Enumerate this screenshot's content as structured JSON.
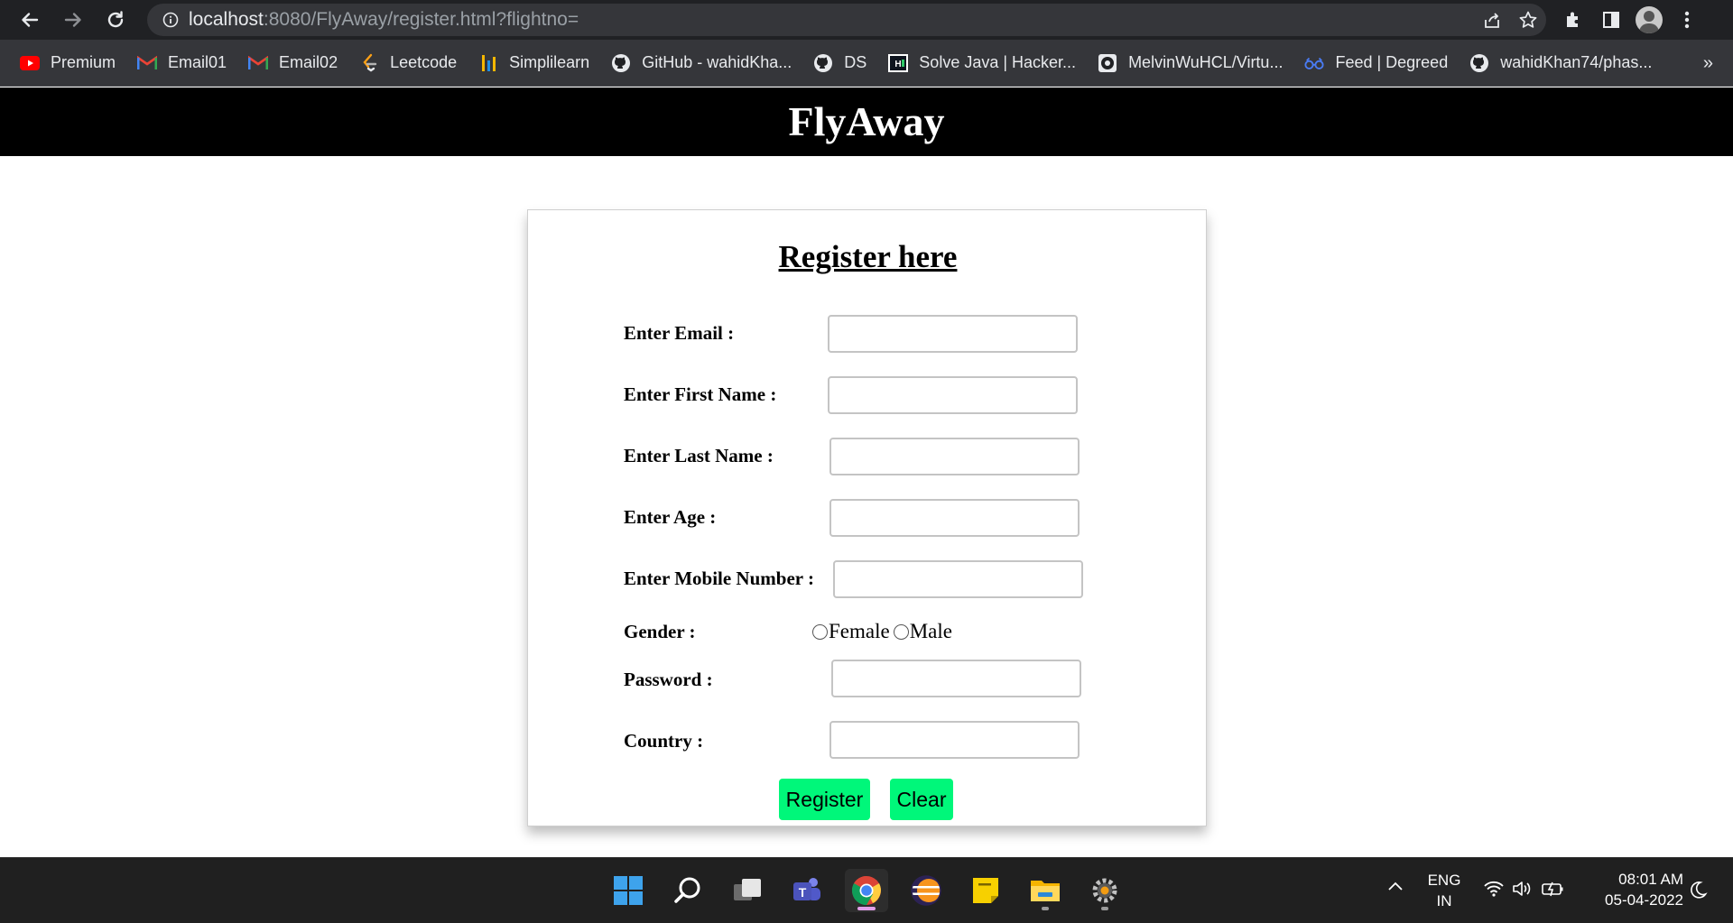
{
  "browser": {
    "url_host": "localhost",
    "url_rest": ":8080/FlyAway/register.html?flightno=",
    "bookmarks": [
      {
        "label": "Premium",
        "icon": "youtube-icon"
      },
      {
        "label": "Email01",
        "icon": "gmail-icon"
      },
      {
        "label": "Email02",
        "icon": "gmail-icon"
      },
      {
        "label": "Leetcode",
        "icon": "leetcode-icon"
      },
      {
        "label": "Simplilearn",
        "icon": "simplilearn-icon"
      },
      {
        "label": "GitHub - wahidKha...",
        "icon": "github-icon"
      },
      {
        "label": "DS",
        "icon": "github-icon"
      },
      {
        "label": "Solve Java | Hacker...",
        "icon": "hackerrank-icon"
      },
      {
        "label": "MelvinWuHCL/Virtu...",
        "icon": "github-icon"
      },
      {
        "label": "Feed | Degreed",
        "icon": "degreed-icon"
      },
      {
        "label": "wahidKhan74/phas...",
        "icon": "github-icon"
      }
    ],
    "more_bookmarks": "»"
  },
  "site": {
    "title": "FlyAway"
  },
  "form": {
    "title": "Register here",
    "fields": {
      "email": {
        "label": "Enter Email :",
        "value": ""
      },
      "first_name": {
        "label": "Enter First Name :",
        "value": ""
      },
      "last_name": {
        "label": "Enter Last Name :",
        "value": ""
      },
      "age": {
        "label": "Enter Age :",
        "value": ""
      },
      "mobile": {
        "label": "Enter Mobile Number :",
        "value": ""
      },
      "password": {
        "label": "Password :",
        "value": ""
      },
      "country": {
        "label": "Country :",
        "value": ""
      }
    },
    "gender": {
      "label": "Gender :",
      "options": [
        "Female",
        "Male"
      ],
      "selected": null
    },
    "register_label": "Register",
    "clear_label": "Clear",
    "button_color": "#00f77a"
  },
  "taskbar": {
    "language": "ENG",
    "region": "IN",
    "time": "08:01 AM",
    "date": "05-04-2022",
    "apps": [
      "start-icon",
      "search-icon",
      "task-view-icon",
      "teams-icon",
      "chrome-icon",
      "eclipse-icon",
      "sticky-notes-icon",
      "file-explorer-icon",
      "settings-icon"
    ]
  }
}
